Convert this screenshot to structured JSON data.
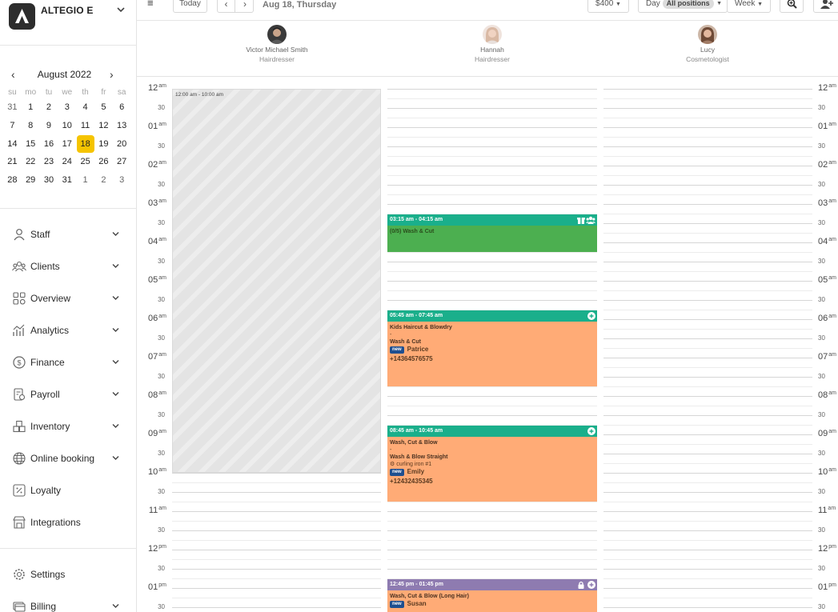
{
  "brand": {
    "name": "ALTEGIO E"
  },
  "mini_calendar": {
    "title": "August 2022",
    "weekdays": [
      "su",
      "mo",
      "tu",
      "we",
      "th",
      "fr",
      "sa"
    ],
    "weeks": [
      [
        "31",
        "1",
        "2",
        "3",
        "4",
        "5",
        "6"
      ],
      [
        "7",
        "8",
        "9",
        "10",
        "11",
        "12",
        "13"
      ],
      [
        "14",
        "15",
        "16",
        "17",
        "18",
        "19",
        "20"
      ],
      [
        "21",
        "22",
        "23",
        "24",
        "25",
        "26",
        "27"
      ],
      [
        "28",
        "29",
        "30",
        "31",
        "1",
        "2",
        "3"
      ]
    ],
    "selected": "18"
  },
  "menu": [
    {
      "label": "Staff",
      "icon": "person-icon"
    },
    {
      "label": "Clients",
      "icon": "people-icon"
    },
    {
      "label": "Overview",
      "icon": "grid-icon"
    },
    {
      "label": "Analytics",
      "icon": "analytics-icon"
    },
    {
      "label": "Finance",
      "icon": "dollar-icon"
    },
    {
      "label": "Payroll",
      "icon": "payroll-icon"
    },
    {
      "label": "Inventory",
      "icon": "boxes-icon"
    },
    {
      "label": "Online booking",
      "icon": "globe-icon"
    },
    {
      "label": "Loyalty",
      "icon": "percent-icon"
    },
    {
      "label": "Integrations",
      "icon": "store-icon"
    }
  ],
  "bottom_menu": [
    {
      "label": "Settings",
      "icon": "gear-icon"
    },
    {
      "label": "Billing",
      "icon": "billing-icon"
    }
  ],
  "topbar": {
    "today": "Today",
    "date": "Aug 18, Thursday",
    "amount": "$400",
    "day": "Day",
    "positions": "All positions",
    "week": "Week"
  },
  "staff": [
    {
      "name": "Victor Michael Smith",
      "role": "Hairdresser"
    },
    {
      "name": "Hannah",
      "role": "Hairdresser"
    },
    {
      "name": "Lucy",
      "role": "Cosmetologist"
    }
  ],
  "hours": [
    "12",
    "01",
    "02",
    "03",
    "04",
    "05",
    "06",
    "07",
    "08",
    "09",
    "10",
    "11",
    "12",
    "01"
  ],
  "ampm": [
    "am",
    "am",
    "am",
    "am",
    "am",
    "am",
    "am",
    "am",
    "am",
    "am",
    "am",
    "am",
    "pm",
    "pm"
  ],
  "half_label": "30",
  "blocked": {
    "text": "12:00 am - 10:00 am"
  },
  "appointments": [
    {
      "time": "03:15 am - 04:15 am",
      "lines": [
        "(0/5) Wash & Cut"
      ],
      "header_color": "#1aaf8b",
      "body_color": "#4caf50"
    },
    {
      "time": "05:45 am - 07:45 am",
      "service1": "Kids Haircut & Blowdry",
      "dash": "-",
      "service2": "Wash & Cut",
      "badge": "new",
      "client": "Patrice",
      "phone": "+14364576575",
      "header_color": "#1aaf8b",
      "body_color": "#ffab76"
    },
    {
      "time": "08:45 am - 10:45 am",
      "service1": "Wash, Cut & Blow",
      "dash": "-",
      "service2": "Wash & Blow Straight",
      "resource": "curling iron #1",
      "badge": "new",
      "client": "Emily",
      "phone": "+12432435345",
      "header_color": "#1aaf8b",
      "body_color": "#ffab76"
    },
    {
      "time": "12:45 pm - 01:45 pm",
      "service1": "Wash, Cut & Blow (Long Hair)",
      "badge": "new",
      "client": "Susan",
      "header_color": "#8e7bb0",
      "body_color": "#ffab76"
    }
  ]
}
